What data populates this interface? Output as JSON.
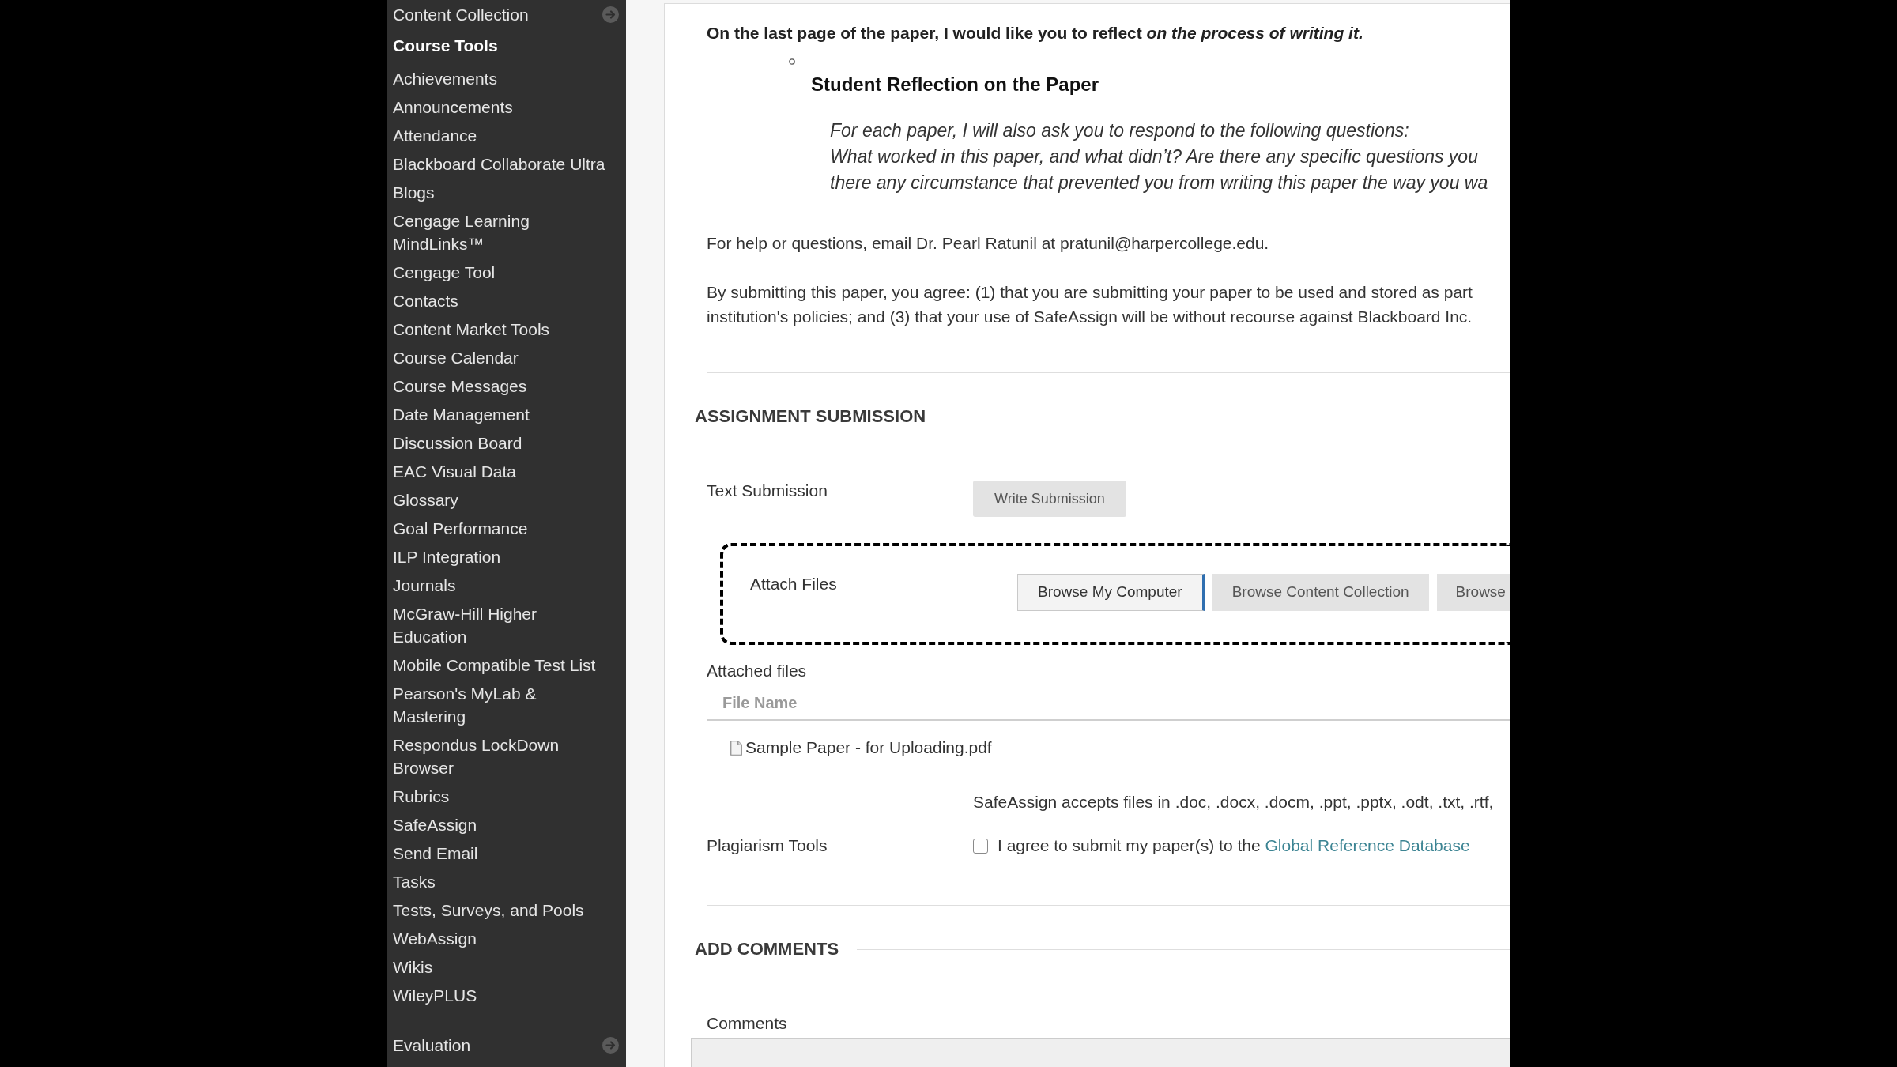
{
  "sidebar": {
    "sections": [
      {
        "title": "Content Collection",
        "expanded": false
      },
      {
        "title": "Course Tools",
        "expanded": true,
        "items": [
          "Achievements",
          "Announcements",
          "Attendance",
          "Blackboard Collaborate Ultra",
          "Blogs",
          "Cengage Learning MindLinks™",
          "Cengage Tool",
          "Contacts",
          "Content Market Tools",
          "Course Calendar",
          "Course Messages",
          "Date Management",
          "Discussion Board",
          "EAC Visual Data",
          "Glossary",
          "Goal Performance",
          "ILP Integration",
          "Journals",
          "McGraw-Hill Higher Education",
          "Mobile Compatible Test List",
          "Pearson's MyLab & Mastering",
          "Respondus LockDown Browser",
          "Rubrics",
          "SafeAssign",
          "Send Email",
          "Tasks",
          "Tests, Surveys, and Pools",
          "WebAssign",
          "Wikis",
          "WileyPLUS"
        ]
      },
      {
        "title": "Evaluation",
        "expanded": false
      }
    ]
  },
  "instructions": {
    "intro": "On the last page of the paper, I would like you to reflect *on the process of writing it.*",
    "reflection_heading": "Student Reflection on the Paper",
    "reflection_lines": [
      "For each paper, I will also ask you to respond to the following questions:",
      "What worked in this paper, and what didn’t? Are there any specific questions you",
      "there any circumstance that prevented you from writing this paper the way you wa"
    ],
    "help_text": "For help or questions, email Dr. Pearl Ratunil at pratunil@harpercollege.edu.",
    "agreement_lines": [
      "By submitting this paper, you agree: (1) that you are submitting your paper to be used and stored as part",
      "institution's policies; and (3) that your use of SafeAssign will be without recourse against Blackboard Inc."
    ]
  },
  "assignment_submission": {
    "title": "ASSIGNMENT SUBMISSION",
    "text_submission": {
      "label": "Text Submission",
      "button": "Write Submission"
    },
    "attach_files": {
      "label": "Attach Files",
      "buttons": [
        {
          "label": "Browse My Computer",
          "focused": true
        },
        {
          "label": "Browse Content Collection",
          "focused": false
        },
        {
          "label": "Browse",
          "focused": false
        }
      ]
    },
    "attached_files": {
      "label": "Attached files",
      "columns": [
        "File Name"
      ],
      "rows": [
        {
          "file_name": "Sample Paper - for Uploading.pdf"
        }
      ]
    },
    "file_types_note": "SafeAssign accepts files in .doc, .docx, .docm, .ppt, .pptx, .odt, .txt, .rtf,",
    "plagiarism": {
      "label": "Plagiarism Tools",
      "checked": false,
      "text": "I agree to submit my paper(s) to the",
      "link": "Global Reference Database"
    }
  },
  "add_comments": {
    "title": "ADD COMMENTS",
    "comments_label": "Comments"
  }
}
